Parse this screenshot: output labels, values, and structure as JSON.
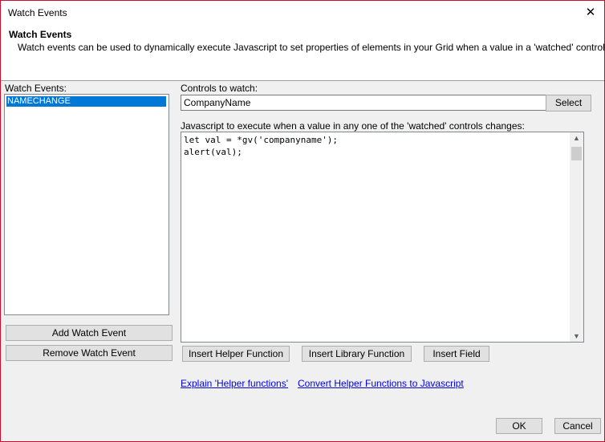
{
  "window": {
    "title": "Watch Events",
    "close_glyph": "✕"
  },
  "header": {
    "title": "Watch Events",
    "description": "Watch events can be used to dynamically execute Javascript to set properties of elements in your Grid when a value in a 'watched' control changes."
  },
  "watch_events": {
    "label": "Watch Events:",
    "items": [
      "NAMECHANGE"
    ],
    "add_button": "Add Watch Event",
    "remove_button": "Remove Watch Event"
  },
  "controls": {
    "label": "Controls to watch:",
    "value": "CompanyName",
    "select_button": "Select"
  },
  "script": {
    "label": "Javascript to execute when a value in any one of the 'watched' controls changes:",
    "lines": [
      "let val = *gv('companyname');",
      "alert(val);"
    ]
  },
  "insert_buttons": {
    "helper": "Insert Helper Function",
    "library": "Insert Library Function",
    "field": "Insert Field"
  },
  "links": {
    "explain": "Explain 'Helper functions'",
    "convert": "Convert Helper Functions to Javascript"
  },
  "footer": {
    "ok": "OK",
    "cancel": "Cancel"
  },
  "colors": {
    "selection": "#0078d7",
    "window_border": "#c8102e",
    "link": "#0000ee"
  },
  "icons": [
    "close-icon",
    "scroll-up-icon",
    "scroll-down-icon"
  ]
}
